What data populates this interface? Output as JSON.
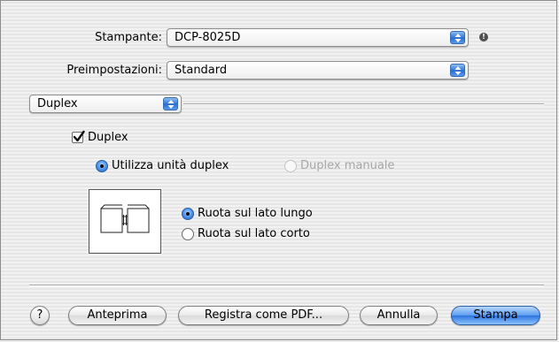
{
  "printer": {
    "label": "Stampante:",
    "value": "DCP-8025D"
  },
  "presets": {
    "label": "Preimpostazioni:",
    "value": "Standard"
  },
  "panel": {
    "value": "Duplex"
  },
  "duplex": {
    "checkbox_label": "Duplex",
    "checked": true,
    "mode_options": [
      {
        "label": "Utilizza unità duplex",
        "selected": true,
        "enabled": true
      },
      {
        "label": "Duplex manuale",
        "selected": false,
        "enabled": false
      }
    ],
    "binding_options": [
      {
        "label": "Ruota sul lato lungo",
        "selected": true
      },
      {
        "label": "Ruota sul lato corto",
        "selected": false
      }
    ]
  },
  "buttons": {
    "help": "?",
    "preview": "Anteprima",
    "save_pdf": "Registra come PDF...",
    "cancel": "Annulla",
    "print": "Stampa"
  },
  "icons": {
    "popup_arrows": "up-down-arrows-icon",
    "printer_status": "exclamation-icon",
    "checkmark": "checkmark-icon",
    "preview": "duplex-long-edge-page-icon"
  },
  "colors": {
    "accent": "#3a7be0",
    "default_button": "#2c73dc"
  }
}
